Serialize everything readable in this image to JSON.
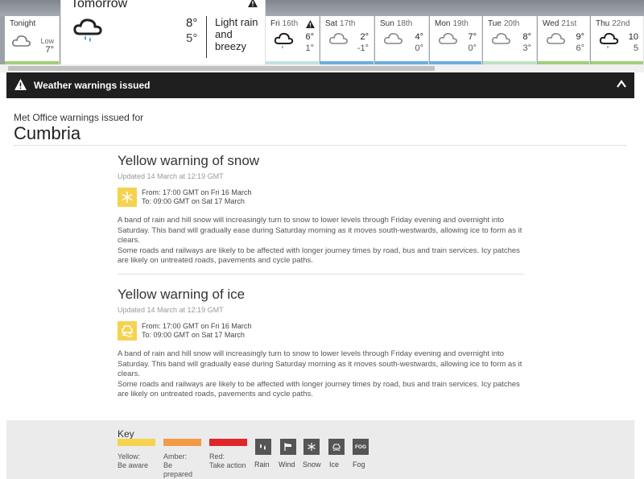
{
  "forecast": {
    "tonight": {
      "name": "Tonight",
      "low_label": "Low",
      "low": "7°"
    },
    "tomorrow": {
      "name": "Tomorrow",
      "high": "8°",
      "low": "5°",
      "description": "Light rain and breezy"
    },
    "days": [
      {
        "day": "Fri",
        "date": "16th",
        "high": "6°",
        "low": "1°",
        "bar_color": "#bfe3e6",
        "warning": true,
        "icon": "rain-cloud-icon"
      },
      {
        "day": "Sat",
        "date": "17th",
        "high": "2°",
        "low": "-1°",
        "bar_color": "#6aaee0",
        "warning": false,
        "icon": "cloud-icon"
      },
      {
        "day": "Sun",
        "date": "18th",
        "high": "4°",
        "low": "0°",
        "bar_color": "#6aaee0",
        "warning": false,
        "icon": "cloud-icon"
      },
      {
        "day": "Mon",
        "date": "19th",
        "high": "7°",
        "low": "0°",
        "bar_color": "#6aaee0",
        "warning": false,
        "icon": "cloud-icon"
      },
      {
        "day": "Tue",
        "date": "20th",
        "high": "8°",
        "low": "3°",
        "bar_color": "#bfe3c0",
        "warning": false,
        "icon": "cloud-icon"
      },
      {
        "day": "Wed",
        "date": "21st",
        "high": "9°",
        "low": "6°",
        "bar_color": "#9fd07a",
        "warning": false,
        "icon": "cloud-icon"
      },
      {
        "day": "Thu",
        "date": "22nd",
        "high": "10",
        "low": "5",
        "bar_color": "#9fd07a",
        "warning": false,
        "icon": "rain-cloud-icon"
      }
    ]
  },
  "warnings_bar": {
    "title": "Weather warnings issued"
  },
  "issued_for_label": "Met Office warnings issued for",
  "region": "Cumbria",
  "warnings": [
    {
      "title": "Yellow warning of snow",
      "updated": "Updated 14 March at 12:19 GMT",
      "from": "From: 17:00 GMT on Fri 16 March",
      "to": "To: 09:00 GMT on Sat 17 March",
      "icon": "snowflake-icon",
      "desc1": "A band of rain and hill snow will increasingly turn to snow to lower levels through Friday evening and overnight into Saturday. This band will gradually ease during Saturday morning as it moves south-westwards, allowing ice to form as it clears.",
      "desc2": "Some roads and railways are likely to be affected with longer journey times by road, bus and train services. Icy patches are likely on untreated roads, pavements and cycle paths."
    },
    {
      "title": "Yellow warning of ice",
      "updated": "Updated 14 March at 12:19 GMT",
      "from": "From: 17:00 GMT on Fri 16 March",
      "to": "To: 09:00 GMT on Sat 17 March",
      "icon": "ice-car-icon",
      "desc1": "A band of rain and hill snow will increasingly turn to snow to lower levels through Friday evening and overnight into Saturday. This band will gradually ease during Saturday morning as it moves south-westwards, allowing ice to form as it clears.",
      "desc2": "Some roads and railways are likely to be affected with longer journey times by road, bus and train services. Icy patches are likely on untreated roads, pavements and cycle paths."
    }
  ],
  "key": {
    "label": "Key",
    "levels": [
      {
        "name": "Yellow:",
        "meaning": "Be aware",
        "color": "#f5d350"
      },
      {
        "name": "Amber:",
        "meaning": "Be prepared",
        "color": "#f39a45"
      },
      {
        "name": "Red:",
        "meaning": "Take action",
        "color": "#e0262b"
      }
    ],
    "types": [
      {
        "label": "Rain",
        "icon": "rain-icon"
      },
      {
        "label": "Wind",
        "icon": "wind-icon"
      },
      {
        "label": "Snow",
        "icon": "snow-icon"
      },
      {
        "label": "Ice",
        "icon": "ice-icon"
      },
      {
        "label": "Fog",
        "icon": "fog-icon",
        "text": "FOG"
      }
    ]
  }
}
